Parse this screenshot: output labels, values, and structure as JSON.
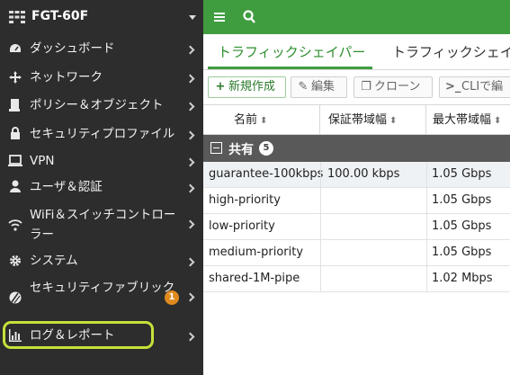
{
  "sidebar": {
    "device_name": "FGT-60F",
    "items": [
      {
        "label": "ダッシュボード",
        "icon": "dashboard-icon"
      },
      {
        "label": "ネットワーク",
        "icon": "network-icon"
      },
      {
        "label": "ポリシー＆オブジェクト",
        "icon": "policy-icon"
      },
      {
        "label": "セキュリティプロファイル",
        "icon": "lock-icon"
      },
      {
        "label": "VPN",
        "icon": "monitor-icon"
      },
      {
        "label": "ユーザ＆認証",
        "icon": "user-icon"
      },
      {
        "label": "WiFi＆スイッチコントローラー",
        "icon": "wifi-icon"
      },
      {
        "label": "システム",
        "icon": "gear-icon"
      },
      {
        "label": "セキュリティファブリック",
        "icon": "fabric-icon",
        "badge": "1"
      },
      {
        "label": "ログ＆レポート",
        "icon": "bar-chart-icon"
      }
    ],
    "highlighted_item": "ログ＆レポート"
  },
  "topbar": {
    "color": "#3f9d3f"
  },
  "tabs": [
    {
      "label": "トラフィックシェイパー",
      "active": true
    },
    {
      "label": "トラフィックシェイ"
    }
  ],
  "toolbar": {
    "create_label": "新規作成",
    "edit_label": "編集",
    "clone_label": "クローン",
    "cli_label": "CLIで編"
  },
  "table": {
    "columns": [
      "名前",
      "保証帯域幅",
      "最大帯域幅"
    ],
    "group": {
      "title": "共有",
      "count": "5"
    },
    "rows": [
      {
        "name": "guarantee-100kbps",
        "guaranteed": "100.00 kbps",
        "max": "1.05 Gbps"
      },
      {
        "name": "high-priority",
        "guaranteed": "",
        "max": "1.05 Gbps"
      },
      {
        "name": "low-priority",
        "guaranteed": "",
        "max": "1.05 Gbps"
      },
      {
        "name": "medium-priority",
        "guaranteed": "",
        "max": "1.05 Gbps"
      },
      {
        "name": "shared-1M-pipe",
        "guaranteed": "",
        "max": "1.02 Mbps"
      }
    ]
  }
}
